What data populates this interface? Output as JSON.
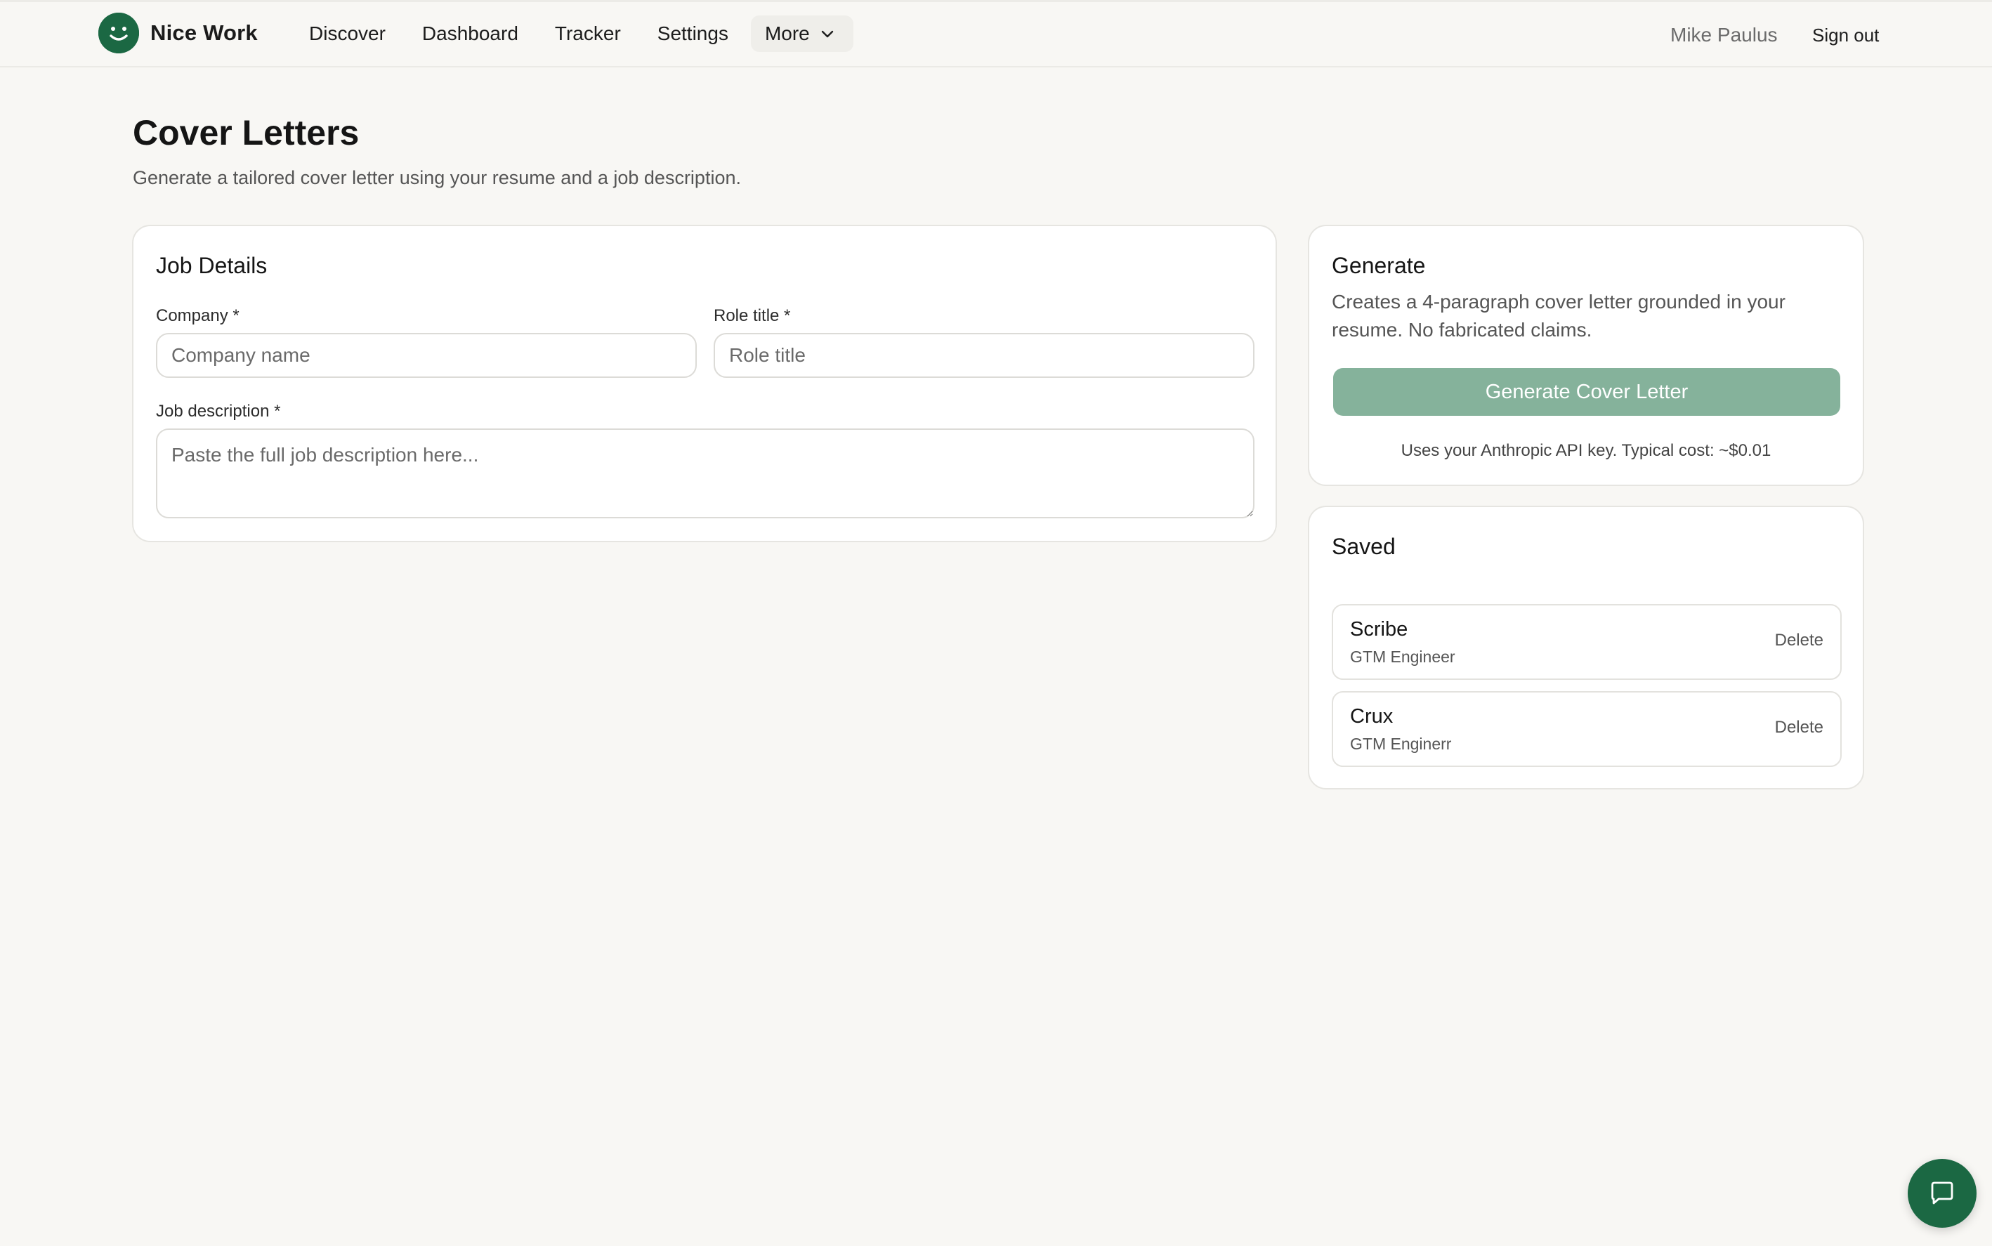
{
  "brand": {
    "name": "Nice Work",
    "icon": "smiley-face-icon",
    "color": "#1b6843"
  },
  "nav": {
    "items": [
      {
        "label": "Discover"
      },
      {
        "label": "Dashboard"
      },
      {
        "label": "Tracker"
      },
      {
        "label": "Settings"
      }
    ],
    "more_label": "More"
  },
  "user": {
    "name": "Mike Paulus",
    "sign_out_label": "Sign out"
  },
  "page": {
    "title": "Cover Letters",
    "subtitle": "Generate a tailored cover letter using your resume and a job description."
  },
  "job_details": {
    "title": "Job Details",
    "company_label": "Company *",
    "company_placeholder": "Company name",
    "company_value": "",
    "role_label": "Role title *",
    "role_placeholder": "Role title",
    "role_value": "",
    "description_label": "Job description *",
    "description_placeholder": "Paste the full job description here...",
    "description_value": ""
  },
  "generate": {
    "title": "Generate",
    "description": "Creates a 4-paragraph cover letter grounded in your resume. No fabricated claims.",
    "button_label": "Generate Cover Letter",
    "button_color": "#85b29b",
    "note": "Uses your Anthropic API key. Typical cost: ~$0.01"
  },
  "saved": {
    "title": "Saved",
    "delete_label": "Delete",
    "items": [
      {
        "company": "Scribe",
        "role": "GTM Engineer"
      },
      {
        "company": "Crux",
        "role": "GTM Enginerr"
      }
    ]
  },
  "chat": {
    "icon": "chat-bubble-icon"
  }
}
